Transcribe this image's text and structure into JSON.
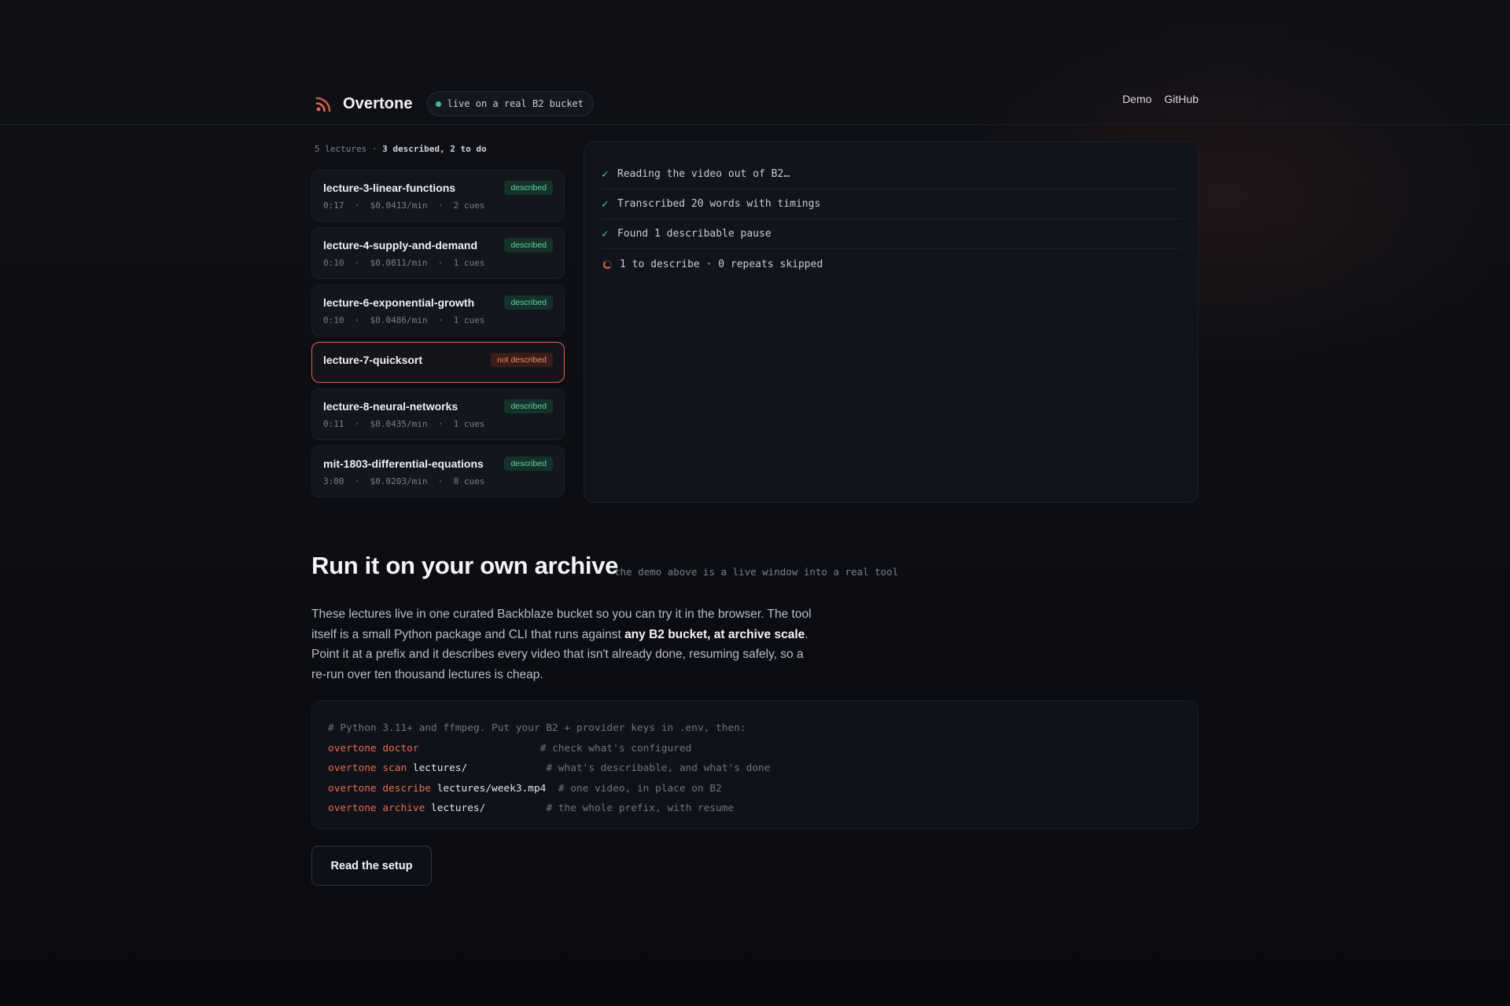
{
  "header": {
    "brand_name": "Overtone",
    "live_label": "live on a real B2 bucket",
    "nav": [
      "Demo",
      "GitHub"
    ]
  },
  "lectures_summary": {
    "count": "5 lectures",
    "separator": "·",
    "status": "3 described, 2 to do"
  },
  "lectures": [
    {
      "title": "lecture-3-linear-functions",
      "status": "described",
      "duration": "0:17",
      "rate": "$0.0413/min",
      "cues": "2 cues"
    },
    {
      "title": "lecture-4-supply-and-demand",
      "status": "described",
      "duration": "0:10",
      "rate": "$0.0811/min",
      "cues": "1 cues"
    },
    {
      "title": "lecture-6-exponential-growth",
      "status": "described",
      "duration": "0:10",
      "rate": "$0.0486/min",
      "cues": "1 cues"
    },
    {
      "title": "lecture-7-quicksort",
      "status": "not described",
      "duration": "",
      "rate": "",
      "cues": ""
    },
    {
      "title": "lecture-8-neural-networks",
      "status": "described",
      "duration": "0:11",
      "rate": "$0.0435/min",
      "cues": "1 cues"
    },
    {
      "title": "mit-1803-differential-equations",
      "status": "described",
      "duration": "3:00",
      "rate": "$0.0203/min",
      "cues": "8 cues"
    }
  ],
  "meta_separator": "·",
  "steps": [
    {
      "icon": "check-icon",
      "text": "Reading the video out of B2…",
      "glyph": "✓"
    },
    {
      "icon": "check-icon",
      "text": "Transcribed 20 words with timings",
      "glyph": "✓"
    },
    {
      "icon": "check-icon",
      "text": "Found 1 describable pause",
      "glyph": "✓"
    },
    {
      "icon": "spinner-icon",
      "text": "1 to describe · 0 repeats skipped",
      "glyph": ""
    }
  ],
  "section": {
    "title": "Run it on your own archive",
    "subtitle": "the demo above is a live window into a real tool",
    "para_1": "These lectures live in one curated Backblaze bucket so you can try it in the browser. The tool itself is a small Python package and CLI that runs against ",
    "para_bold": "any B2 bucket, at archive scale",
    "para_2": ". Point it at a prefix and it describes every video that isn't already done, resuming safely, so a re-run over ten thousand lectures is cheap."
  },
  "code": {
    "comment": "# Python 3.11+ and ffmpeg. Put your B2 + provider keys in .env, then:",
    "lines": [
      {
        "cmd": "overtone doctor",
        "arg": "",
        "pad": "                    ",
        "comment": "# check what's configured"
      },
      {
        "cmd": "overtone scan",
        "arg": " lectures/",
        "pad": "             ",
        "comment": "# what's describable, and what's done"
      },
      {
        "cmd": "overtone describe",
        "arg": " lectures/week3.mp4",
        "pad": "  ",
        "comment": "# one video, in place on B2"
      },
      {
        "cmd": "overtone archive",
        "arg": " lectures/",
        "pad": "          ",
        "comment": "# the whole prefix, with resume"
      }
    ]
  },
  "cta_label": "Read the setup",
  "colors": {
    "accent": "#ea6a50",
    "success": "#4fcf95",
    "background": "#0b0d13"
  }
}
